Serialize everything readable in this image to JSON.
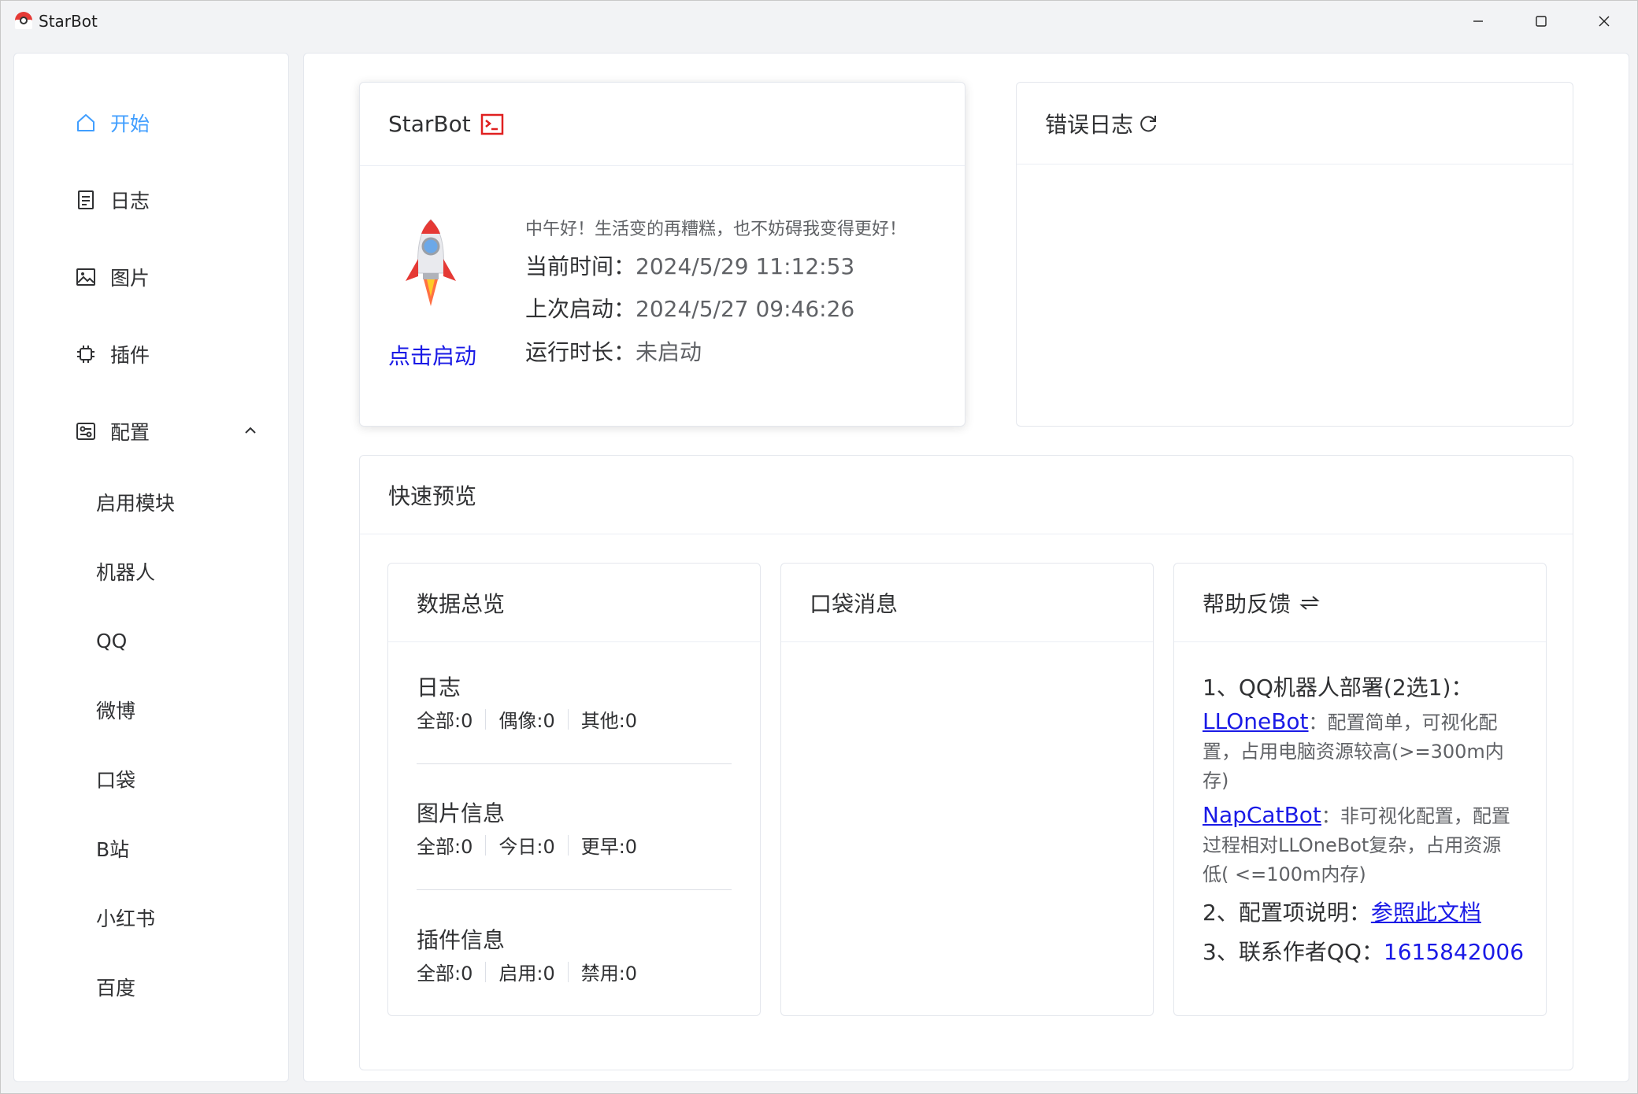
{
  "window": {
    "title": "StarBot"
  },
  "sidebar": {
    "items": [
      {
        "label": "开始",
        "icon": "home-icon",
        "active": true
      },
      {
        "label": "日志",
        "icon": "document-icon"
      },
      {
        "label": "图片",
        "icon": "image-icon"
      },
      {
        "label": "插件",
        "icon": "chip-icon"
      },
      {
        "label": "配置",
        "icon": "settings-panel-icon",
        "expanded": true
      }
    ],
    "config_children": [
      "启用模块",
      "机器人",
      "QQ",
      "微博",
      "口袋",
      "B站",
      "小红书",
      "百度"
    ]
  },
  "starbot_card": {
    "title": "StarBot",
    "start_label": "点击启动",
    "greeting": "中午好！生活变的再糟糕，也不妨碍我变得更好！",
    "current_time_label": "当前时间：",
    "current_time": "2024/5/29 11:12:53",
    "last_start_label": "上次启动：",
    "last_start": "2024/5/27 09:46:26",
    "uptime_label": "运行时长：",
    "uptime": "未启动"
  },
  "error_log": {
    "title": "错误日志"
  },
  "quick_preview": {
    "title": "快速预览",
    "data_overview": {
      "title": "数据总览",
      "groups": [
        {
          "title": "日志",
          "stats": [
            "全部:0",
            "偶像:0",
            "其他:0"
          ]
        },
        {
          "title": "图片信息",
          "stats": [
            "全部:0",
            "今日:0",
            "更早:0"
          ]
        },
        {
          "title": "插件信息",
          "stats": [
            "全部:0",
            "启用:0",
            "禁用:0"
          ]
        }
      ]
    },
    "pocket_messages": {
      "title": "口袋消息"
    },
    "help": {
      "title": "帮助反馈",
      "line1": "1、QQ机器人部署(2选1)：",
      "llonebot_link": "LLOneBot",
      "llonebot_desc": "：配置简单，可视化配置，占用电脑资源较高(>=300m内存)",
      "napcat_link": "NapCatBot",
      "napcat_desc": "：非可视化配置，配置过程相对LLOneBot复杂，占用资源低( <=100m内存)",
      "line2_label": "2、配置项说明：",
      "doc_link": "参照此文档",
      "line3_label": "3、联系作者QQ：",
      "qq": "1615842006"
    }
  },
  "colors": {
    "accent": "#409eff",
    "link": "#1a1ae6",
    "terminal_red": "#e02020"
  }
}
